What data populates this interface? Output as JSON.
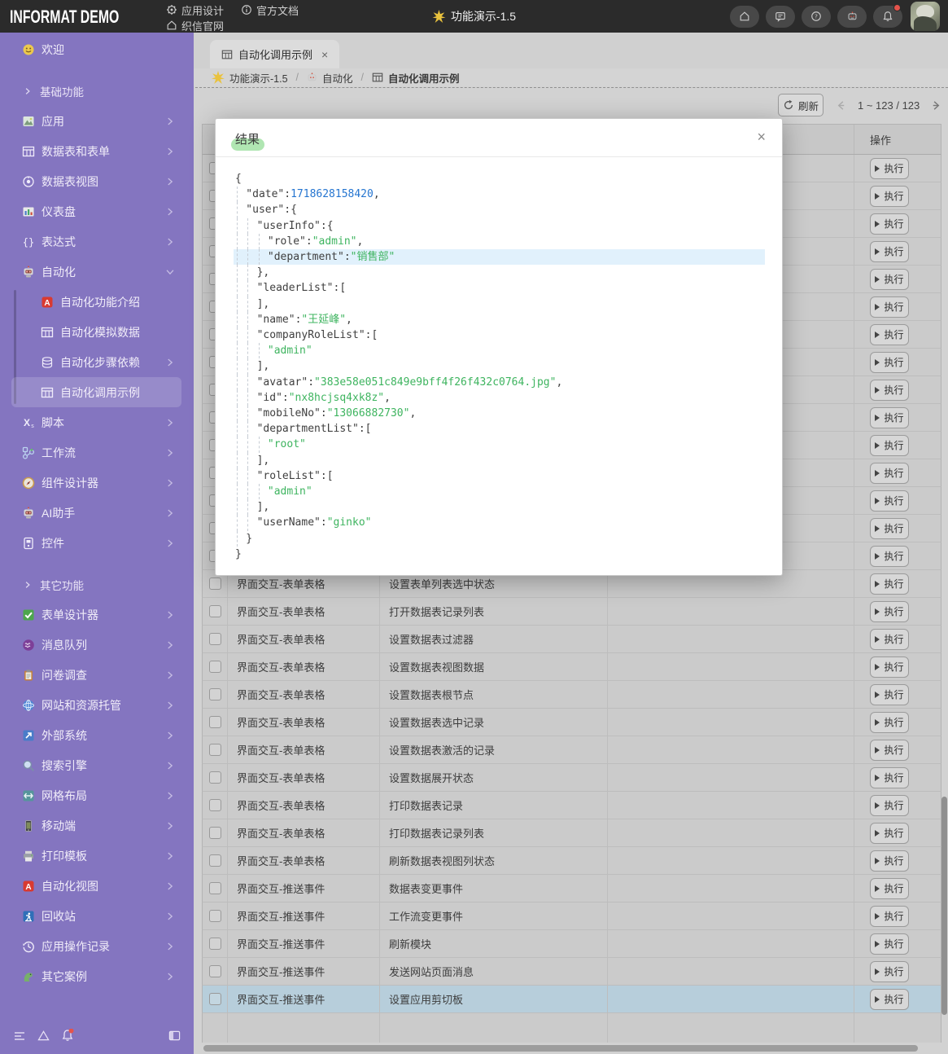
{
  "topbar": {
    "logo": "INFORMAT DEMO",
    "menu": [
      {
        "label": "应用设计",
        "icon": "gear"
      },
      {
        "label": "官方文档",
        "icon": "info"
      },
      {
        "label": "织信官网",
        "icon": "home"
      }
    ],
    "center": {
      "label": "功能演示-1.5",
      "icon": "star"
    },
    "right": [
      {
        "icon": "home"
      },
      {
        "icon": "chat"
      },
      {
        "icon": "help"
      },
      {
        "icon": "robot"
      },
      {
        "icon": "bell",
        "badge": true
      }
    ]
  },
  "sidebar": {
    "items": [
      {
        "label": "欢迎",
        "icon": "smiley"
      },
      {
        "label": "基础功能",
        "group": true
      },
      {
        "label": "应用",
        "icon": "app",
        "chevron": "right"
      },
      {
        "label": "数据表和表单",
        "icon": "table",
        "chevron": "right"
      },
      {
        "label": "数据表视图",
        "icon": "view",
        "chevron": "right"
      },
      {
        "label": "仪表盘",
        "icon": "dashboard",
        "chevron": "right"
      },
      {
        "label": "表达式",
        "icon": "braces",
        "chevron": "right"
      },
      {
        "label": "自动化",
        "icon": "robot",
        "chevron": "down",
        "children": [
          {
            "label": "自动化功能介绍",
            "icon": "a-red"
          },
          {
            "label": "自动化模拟数据",
            "icon": "table"
          },
          {
            "label": "自动化步骤依赖",
            "icon": "db",
            "chevron": "right"
          },
          {
            "label": "自动化调用示例",
            "icon": "table",
            "selected": true
          }
        ]
      },
      {
        "label": "脚本",
        "icon": "script",
        "chevron": "right"
      },
      {
        "label": "工作流",
        "icon": "workflow",
        "chevron": "right"
      },
      {
        "label": "组件设计器",
        "icon": "compass",
        "chevron": "right"
      },
      {
        "label": "AI助手",
        "icon": "robot",
        "chevron": "right"
      },
      {
        "label": "控件",
        "icon": "widget",
        "chevron": "right"
      },
      {
        "label": "其它功能",
        "group": true
      },
      {
        "label": "表单设计器",
        "icon": "check",
        "chevron": "right"
      },
      {
        "label": "消息队列",
        "icon": "queue",
        "chevron": "right"
      },
      {
        "label": "问卷调查",
        "icon": "clipboard",
        "chevron": "right"
      },
      {
        "label": "网站和资源托管",
        "icon": "globe",
        "chevron": "right"
      },
      {
        "label": "外部系统",
        "icon": "external",
        "chevron": "right"
      },
      {
        "label": "搜索引擎",
        "icon": "search",
        "chevron": "right"
      },
      {
        "label": "网格布局",
        "icon": "gridlayout",
        "chevron": "right"
      },
      {
        "label": "移动端",
        "icon": "mobile",
        "chevron": "right"
      },
      {
        "label": "打印模板",
        "icon": "printer",
        "chevron": "right"
      },
      {
        "label": "自动化视图",
        "icon": "a-red",
        "chevron": "right"
      },
      {
        "label": "回收站",
        "icon": "recycle",
        "chevron": "right"
      },
      {
        "label": "应用操作记录",
        "icon": "history",
        "chevron": "right"
      },
      {
        "label": "其它案例",
        "icon": "dino",
        "chevron": "right"
      }
    ]
  },
  "tab": {
    "label": "自动化调用示例",
    "icon": "grid",
    "close": "×"
  },
  "breadcrumb": [
    {
      "label": "功能演示-1.5",
      "icon": "star"
    },
    {
      "label": "自动化",
      "icon": "robot"
    },
    {
      "label": "自动化调用示例",
      "icon": "grid"
    }
  ],
  "toolbar": {
    "refresh": "刷新",
    "pagination": "1 ~ 123 / 123"
  },
  "table": {
    "action_header": "操作",
    "action_label": "执行",
    "hidden_rows": 15,
    "rows": [
      {
        "type": "界面交互-表单表格",
        "name": "设置表单列表选中状态"
      },
      {
        "type": "界面交互-表单表格",
        "name": "打开数据表记录列表"
      },
      {
        "type": "界面交互-表单表格",
        "name": "设置数据表过滤器"
      },
      {
        "type": "界面交互-表单表格",
        "name": "设置数据表视图数据"
      },
      {
        "type": "界面交互-表单表格",
        "name": "设置数据表根节点"
      },
      {
        "type": "界面交互-表单表格",
        "name": "设置数据表选中记录"
      },
      {
        "type": "界面交互-表单表格",
        "name": "设置数据表激活的记录"
      },
      {
        "type": "界面交互-表单表格",
        "name": "设置数据展开状态"
      },
      {
        "type": "界面交互-表单表格",
        "name": "打印数据表记录"
      },
      {
        "type": "界面交互-表单表格",
        "name": "打印数据表记录列表"
      },
      {
        "type": "界面交互-表单表格",
        "name": "刷新数据表视图列状态"
      },
      {
        "type": "界面交互-推送事件",
        "name": "数据表变更事件"
      },
      {
        "type": "界面交互-推送事件",
        "name": "工作流变更事件"
      },
      {
        "type": "界面交互-推送事件",
        "name": "刷新模块"
      },
      {
        "type": "界面交互-推送事件",
        "name": "发送网站页面消息"
      },
      {
        "type": "界面交互-推送事件",
        "name": "设置应用剪切板",
        "selected": true
      }
    ]
  },
  "modal": {
    "title": "结果",
    "close": "×",
    "code": [
      {
        "i": 0,
        "t": [
          [
            "p",
            "{"
          ]
        ]
      },
      {
        "i": 1,
        "t": [
          [
            "p",
            "\"date\""
          ],
          [
            "p",
            ":"
          ],
          [
            "n",
            "1718628158420"
          ],
          [
            "p",
            ","
          ]
        ]
      },
      {
        "i": 1,
        "t": [
          [
            "p",
            "\"user\""
          ],
          [
            "p",
            ":{"
          ]
        ]
      },
      {
        "i": 2,
        "t": [
          [
            "p",
            "\"userInfo\""
          ],
          [
            "p",
            ":{"
          ]
        ]
      },
      {
        "i": 3,
        "t": [
          [
            "p",
            "\"role\""
          ],
          [
            "p",
            ":"
          ],
          [
            "s",
            "\"admin\""
          ],
          [
            "p",
            ","
          ]
        ]
      },
      {
        "i": 3,
        "hl": true,
        "t": [
          [
            "p",
            "\"department\""
          ],
          [
            "p",
            ":"
          ],
          [
            "s",
            "\"销售部\""
          ]
        ]
      },
      {
        "i": 2,
        "t": [
          [
            "p",
            "},"
          ]
        ]
      },
      {
        "i": 2,
        "t": [
          [
            "p",
            "\"leaderList\""
          ],
          [
            "p",
            ":["
          ]
        ]
      },
      {
        "i": 2,
        "t": [
          [
            "p",
            "],"
          ]
        ]
      },
      {
        "i": 2,
        "t": [
          [
            "p",
            "\"name\""
          ],
          [
            "p",
            ":"
          ],
          [
            "s",
            "\"王延峰\""
          ],
          [
            "p",
            ","
          ]
        ]
      },
      {
        "i": 2,
        "t": [
          [
            "p",
            "\"companyRoleList\""
          ],
          [
            "p",
            ":["
          ]
        ]
      },
      {
        "i": 3,
        "t": [
          [
            "s",
            "\"admin\""
          ]
        ]
      },
      {
        "i": 2,
        "t": [
          [
            "p",
            "],"
          ]
        ]
      },
      {
        "i": 2,
        "t": [
          [
            "p",
            "\"avatar\""
          ],
          [
            "p",
            ":"
          ],
          [
            "s",
            "\"383e58e051c849e9bff4f26f432c0764.jpg\""
          ],
          [
            "p",
            ","
          ]
        ]
      },
      {
        "i": 2,
        "t": [
          [
            "p",
            "\"id\""
          ],
          [
            "p",
            ":"
          ],
          [
            "s",
            "\"nx8hcjsq4xk8z\""
          ],
          [
            "p",
            ","
          ]
        ]
      },
      {
        "i": 2,
        "t": [
          [
            "p",
            "\"mobileNo\""
          ],
          [
            "p",
            ":"
          ],
          [
            "s",
            "\"13066882730\""
          ],
          [
            "p",
            ","
          ]
        ]
      },
      {
        "i": 2,
        "t": [
          [
            "p",
            "\"departmentList\""
          ],
          [
            "p",
            ":["
          ]
        ]
      },
      {
        "i": 3,
        "t": [
          [
            "s",
            "\"root\""
          ]
        ]
      },
      {
        "i": 2,
        "t": [
          [
            "p",
            "],"
          ]
        ]
      },
      {
        "i": 2,
        "t": [
          [
            "p",
            "\"roleList\""
          ],
          [
            "p",
            ":["
          ]
        ]
      },
      {
        "i": 3,
        "t": [
          [
            "s",
            "\"admin\""
          ]
        ]
      },
      {
        "i": 2,
        "t": [
          [
            "p",
            "],"
          ]
        ]
      },
      {
        "i": 2,
        "t": [
          [
            "p",
            "\"userName\""
          ],
          [
            "p",
            ":"
          ],
          [
            "s",
            "\"ginko\""
          ]
        ]
      },
      {
        "i": 1,
        "t": [
          [
            "p",
            "}"
          ]
        ]
      },
      {
        "i": 0,
        "t": [
          [
            "p",
            "}"
          ]
        ]
      }
    ]
  }
}
